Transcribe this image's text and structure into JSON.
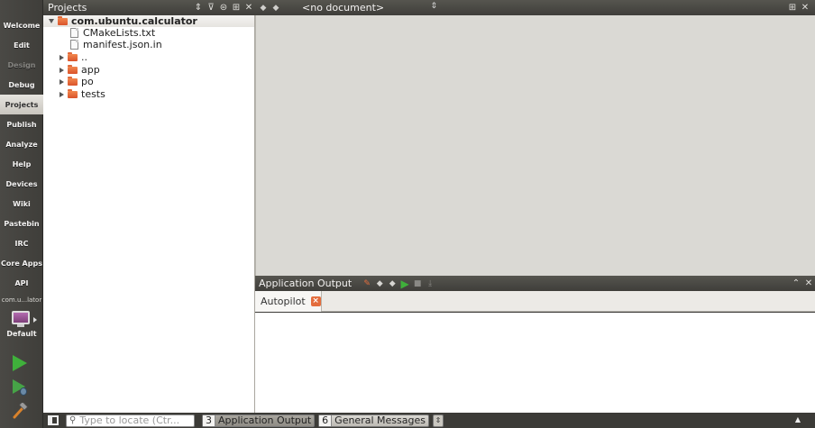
{
  "modes": [
    {
      "label": "Welcome",
      "state": "normal"
    },
    {
      "label": "Edit",
      "state": "normal"
    },
    {
      "label": "Design",
      "state": "disabled"
    },
    {
      "label": "Debug",
      "state": "normal"
    },
    {
      "label": "Projects",
      "state": "active"
    },
    {
      "label": "Publish",
      "state": "normal"
    },
    {
      "label": "Analyze",
      "state": "normal"
    },
    {
      "label": "Help",
      "state": "normal"
    },
    {
      "label": "Devices",
      "state": "normal"
    },
    {
      "label": "Wiki",
      "state": "normal"
    },
    {
      "label": "Pastebin",
      "state": "normal"
    },
    {
      "label": "IRC",
      "state": "normal"
    },
    {
      "label": "Core Apps",
      "state": "normal"
    },
    {
      "label": "API",
      "state": "normal"
    }
  ],
  "kit": {
    "project_label": "com.u...lator",
    "config_label": "Default"
  },
  "projects_pane": {
    "title": "Projects",
    "tree": [
      {
        "label": "com.ubuntu.calculator",
        "type": "root",
        "expanded": true
      },
      {
        "label": "CMakeLists.txt",
        "type": "file"
      },
      {
        "label": "manifest.json.in",
        "type": "file"
      },
      {
        "label": "..",
        "type": "folder"
      },
      {
        "label": "app",
        "type": "folder"
      },
      {
        "label": "po",
        "type": "folder"
      },
      {
        "label": "tests",
        "type": "folder"
      }
    ]
  },
  "editor": {
    "document_label": "<no document>"
  },
  "output_pane": {
    "title": "Application Output",
    "tabs": [
      {
        "label": "Autopilot"
      }
    ]
  },
  "statusbar": {
    "locator_placeholder": "Type to locate (Ctr...",
    "buttons": [
      {
        "num": "3",
        "label": "Application Output",
        "active": true
      },
      {
        "num": "6",
        "label": "General Messages",
        "active": false
      }
    ]
  },
  "colors": {
    "accent": "#e46d3d",
    "run_green": "#3fb03b",
    "bar_dark": "#3c3b37"
  }
}
